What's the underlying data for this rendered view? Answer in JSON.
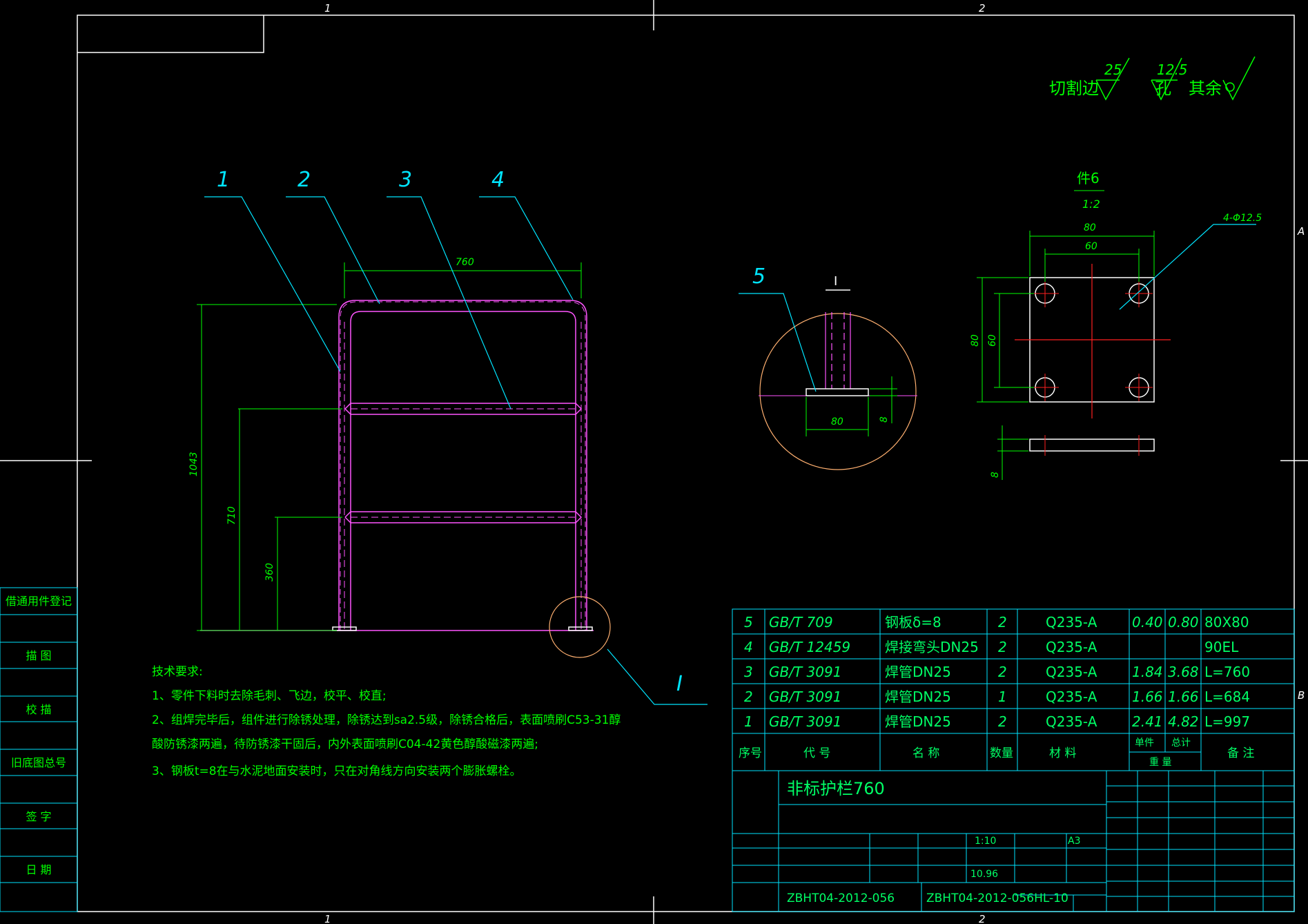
{
  "colors": {
    "background": "#000000",
    "frame": "#ffffff",
    "dimension": "#00ff00",
    "leader": "#00e5ff",
    "pipe": "#ff55ff",
    "center": "#ff2020",
    "detail": "#ffb070",
    "table_text": "#00ff66"
  },
  "zones": {
    "top_1": "1",
    "top_2": "2",
    "bottom_1": "1",
    "bottom_2": "2",
    "right_a": "A",
    "right_b": "B"
  },
  "roughness": {
    "cut_edge_label": "切割边",
    "cut_edge_value": "25",
    "hole_label": "孔",
    "hole_value": "12.5",
    "other_label": "其余"
  },
  "main_view": {
    "balloons": [
      "1",
      "2",
      "3",
      "4"
    ],
    "dim_width": "760",
    "dim_height": "1043",
    "dim_mid": "710",
    "dim_low": "360",
    "detail_mark": "I"
  },
  "detail_view": {
    "title": "I",
    "balloon": "5",
    "dim_plate_width": "80",
    "dim_plate_thick": "8"
  },
  "part6_view": {
    "title": "件6",
    "scale": "1:2",
    "dim_outer_w": "80",
    "dim_inner_w": "60",
    "dim_outer_h": "80",
    "dim_inner_h": "60",
    "hole_callout": "4-Φ12.5",
    "dim_thick": "8"
  },
  "tech_requirements": {
    "heading": "技术要求:",
    "lines": [
      "1、零件下料时去除毛刺、飞边，校平、校直;",
      "2、组焊完毕后，组件进行除锈处理，除锈达到sa2.5级，除锈合格后，表面喷刷C53-31醇",
      "酸防锈漆两遍，待防锈漆干固后，内外表面喷刷C04-42黄色醇酸磁漆两遍;",
      "3、钢板t=8在与水泥地面安装时，只在对角线方向安装两个膨胀螺栓。"
    ]
  },
  "left_strip": {
    "items": [
      "借通用件登记",
      "描  图",
      "校  描",
      "旧底图总号",
      "签  字",
      "日  期"
    ]
  },
  "bom": {
    "rows": [
      {
        "no": "5",
        "code": "GB/T 709",
        "name": "钢板δ=8",
        "qty": "2",
        "material": "Q235-A",
        "unit_wt": "0.40",
        "total_wt": "0.80",
        "note": "80X80"
      },
      {
        "no": "4",
        "code": "GB/T 12459",
        "name": "焊接弯头DN25",
        "qty": "2",
        "material": "Q235-A",
        "unit_wt": "",
        "total_wt": "",
        "note": "90EL"
      },
      {
        "no": "3",
        "code": "GB/T 3091",
        "name": "焊管DN25",
        "qty": "2",
        "material": "Q235-A",
        "unit_wt": "1.84",
        "total_wt": "3.68",
        "note": "L=760"
      },
      {
        "no": "2",
        "code": "GB/T 3091",
        "name": "焊管DN25",
        "qty": "1",
        "material": "Q235-A",
        "unit_wt": "1.66",
        "total_wt": "1.66",
        "note": "L=684"
      },
      {
        "no": "1",
        "code": "GB/T 3091",
        "name": "焊管DN25",
        "qty": "2",
        "material": "Q235-A",
        "unit_wt": "2.41",
        "total_wt": "4.82",
        "note": "L=997"
      }
    ],
    "header": {
      "no": "序号",
      "code": "代  号",
      "name": "名  称",
      "qty": "数量",
      "material": "材  料",
      "unit": "单件",
      "total": "总计",
      "weight": "重  量",
      "note": "备  注"
    }
  },
  "title_block": {
    "title": "非标护栏760",
    "scale": "1:10",
    "sheet": "A3",
    "weight": "10.96",
    "drawing_no": "ZBHT04-2012-056",
    "drawing_no_2": "ZBHT04-2012-056HL-10"
  }
}
